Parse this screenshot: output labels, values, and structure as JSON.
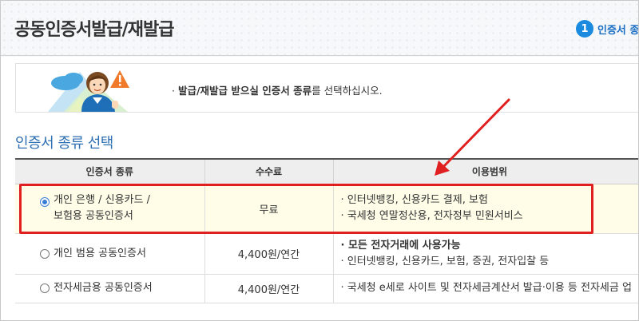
{
  "header": {
    "title": "공동인증서발급/재발급",
    "step_number": "1",
    "step_label": "인증서 종"
  },
  "notice": {
    "bullet": "·",
    "bold_text": "발급/재발급 받으실 인증서 종류",
    "rest_text": "를 선택하십시오."
  },
  "section": {
    "title": "인증서 종류 선택"
  },
  "table": {
    "headers": [
      "인증서 종류",
      "수수료",
      "이용범위"
    ],
    "rows": [
      {
        "type_lines": [
          "개인 은행 / 신용카드 /",
          "보험용 공동인증서"
        ],
        "selected": true,
        "fee": "무료",
        "usage": [
          "· 인터넷뱅킹, 신용카드 결제, 보험",
          "· 국세청 연말정산용, 전자정부 민원서비스"
        ]
      },
      {
        "type_lines": [
          "개인 범용 공동인증서"
        ],
        "selected": false,
        "fee": "4,400원/연간",
        "usage_bold": "· 모든 전자거래에 사용가능",
        "usage": [
          "· 인터넷뱅킹, 신용카드, 보험, 증권, 전자입찰 등"
        ]
      },
      {
        "type_lines": [
          "전자세금용 공동인증서"
        ],
        "selected": false,
        "fee": "4,400원/연간",
        "usage": [
          "· 국세청 e세로 사이트 및 전자세금계산서 발급·이용 등 전자세금 업"
        ]
      }
    ]
  },
  "colors": {
    "accent": "#1b8be0",
    "highlight": "#e02020",
    "selected_row_bg": "#fffde8",
    "fee_text": "#1b78c8"
  }
}
